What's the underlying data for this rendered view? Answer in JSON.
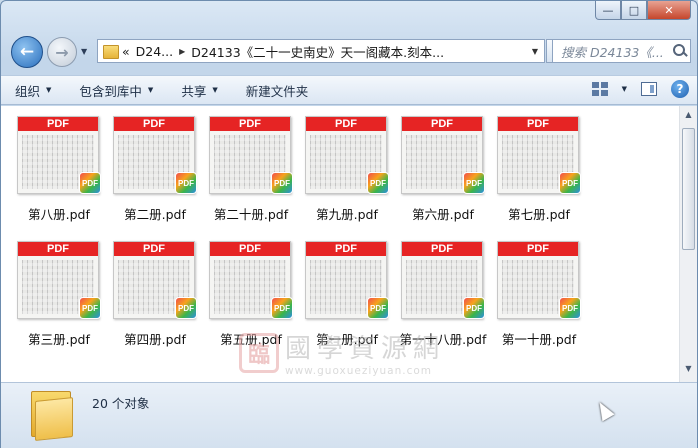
{
  "window": {
    "caption_buttons": {
      "minimize": "—",
      "maximize": "□",
      "close": "✕"
    }
  },
  "nav": {
    "back_glyph": "←",
    "forward_glyph": "→",
    "history_glyph": "▼",
    "address": {
      "prefix": "«",
      "crumb1": "D24...",
      "separator": "▶",
      "crumb2": "D24133《二十一史南史》天一阁藏本.刻本...",
      "dropdown_glyph": "▼",
      "refresh_glyph": "⟳"
    },
    "search": {
      "placeholder": "搜索 D24133《..."
    }
  },
  "toolbar": {
    "organize": "组织",
    "include_library": "包含到库中",
    "share": "共享",
    "new_folder": "新建文件夹",
    "dropdown_glyph": "▼",
    "help_glyph": "?"
  },
  "files": {
    "band_label": "PDF",
    "badge_label": "PDF",
    "items": [
      {
        "name": "第八册.pdf"
      },
      {
        "name": "第二册.pdf"
      },
      {
        "name": "第二十册.pdf"
      },
      {
        "name": "第九册.pdf"
      },
      {
        "name": "第六册.pdf"
      },
      {
        "name": "第七册.pdf"
      },
      {
        "name": "第三册.pdf"
      },
      {
        "name": "第四册.pdf"
      },
      {
        "name": "第五册.pdf"
      },
      {
        "name": "第一册.pdf"
      },
      {
        "name": "第一十八册.pdf"
      },
      {
        "name": "第一十册.pdf"
      }
    ]
  },
  "watermark": {
    "seal": "臨",
    "text": "國學資源網",
    "url": "www.guoxueziyuan.com"
  },
  "scrollbar": {
    "up_glyph": "▲",
    "down_glyph": "▼"
  },
  "status": {
    "count_text": "20 个对象"
  }
}
